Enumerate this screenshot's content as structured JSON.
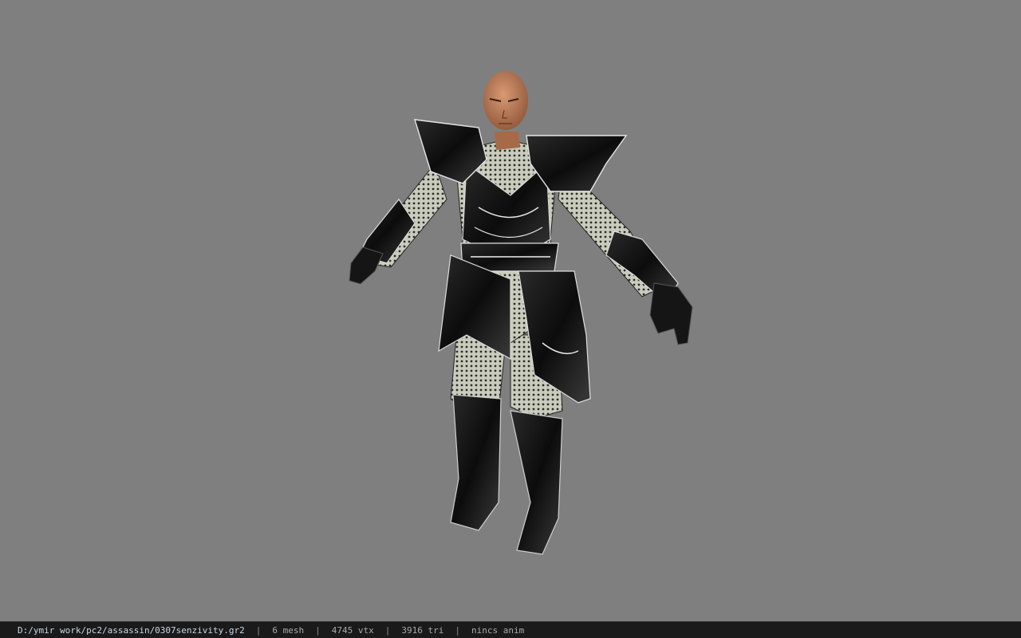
{
  "viewer": {
    "background_color": "#7f7f7f",
    "model_icon": "armored-character-model"
  },
  "status": {
    "file_path": "D:/ymir work/pc2/assassin/0307senzivity.gr2",
    "separator": "|",
    "mesh_count": "6 mesh",
    "vertex_count": "4745 vtx",
    "triangle_count": "3916 tri",
    "animation": "nincs anim"
  }
}
